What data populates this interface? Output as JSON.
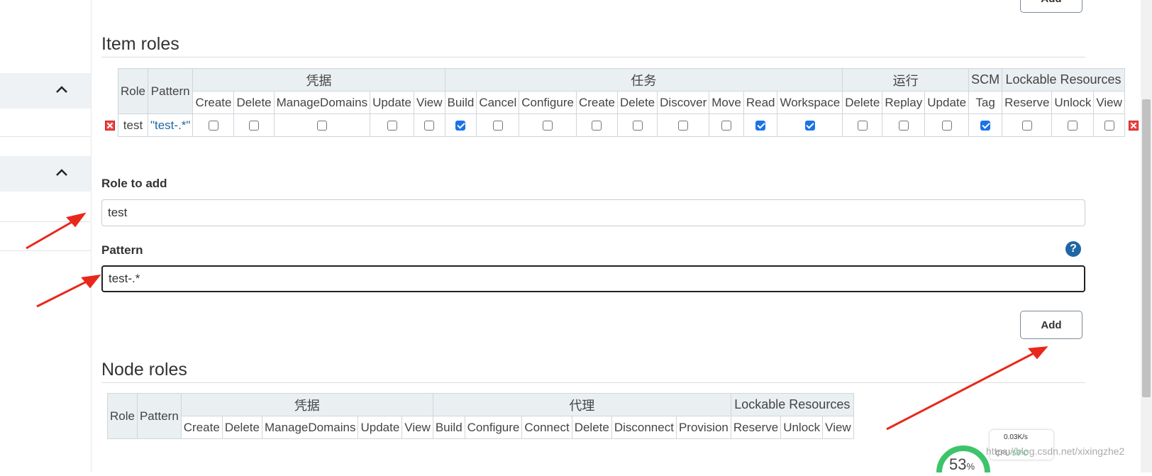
{
  "top_add_button": "Add",
  "item_roles": {
    "heading": "Item roles",
    "headers": {
      "role": "Role",
      "pattern": "Pattern"
    },
    "groups": [
      {
        "label": "凭据",
        "perms": [
          "Create",
          "Delete",
          "ManageDomains",
          "Update",
          "View"
        ]
      },
      {
        "label": "任务",
        "perms": [
          "Build",
          "Cancel",
          "Configure",
          "Create",
          "Delete",
          "Discover",
          "Move",
          "Read",
          "Workspace"
        ]
      },
      {
        "label": "运行",
        "perms": [
          "Delete",
          "Replay",
          "Update"
        ]
      },
      {
        "label": "SCM",
        "perms": [
          "Tag"
        ]
      },
      {
        "label": "Lockable Resources",
        "perms": [
          "Reserve",
          "Unlock",
          "View"
        ]
      }
    ],
    "rows": [
      {
        "role": "test",
        "pattern": "\"test-.*\"",
        "checks": [
          false,
          false,
          false,
          false,
          false,
          true,
          false,
          false,
          false,
          false,
          false,
          false,
          true,
          true,
          false,
          false,
          false,
          true,
          false,
          false,
          false
        ]
      }
    ]
  },
  "role_to_add": {
    "label": "Role to add",
    "value": "test"
  },
  "pattern": {
    "label": "Pattern",
    "value": "test-.*",
    "help": "?"
  },
  "add_button": "Add",
  "node_roles": {
    "heading": "Node roles",
    "headers": {
      "role": "Role",
      "pattern": "Pattern"
    },
    "groups": [
      {
        "label": "凭据",
        "perms": [
          "Create",
          "Delete",
          "ManageDomains",
          "Update",
          "View"
        ]
      },
      {
        "label": "代理",
        "perms": [
          "Build",
          "Configure",
          "Connect",
          "Delete",
          "Disconnect",
          "Provision"
        ]
      },
      {
        "label": "Lockable Resources",
        "perms": [
          "Reserve",
          "Unlock",
          "View"
        ]
      }
    ]
  },
  "widget": {
    "percent": "53",
    "unit": "%",
    "speed": "0.03K/s",
    "cpu": "CPU",
    "cpu_val": "58°C"
  },
  "watermark": "https://blog.csdn.net/xixingzhe2",
  "colors": {
    "accent": "#1f66a6",
    "arrow": "#e8281b",
    "checkbox": "#1a73e8"
  }
}
